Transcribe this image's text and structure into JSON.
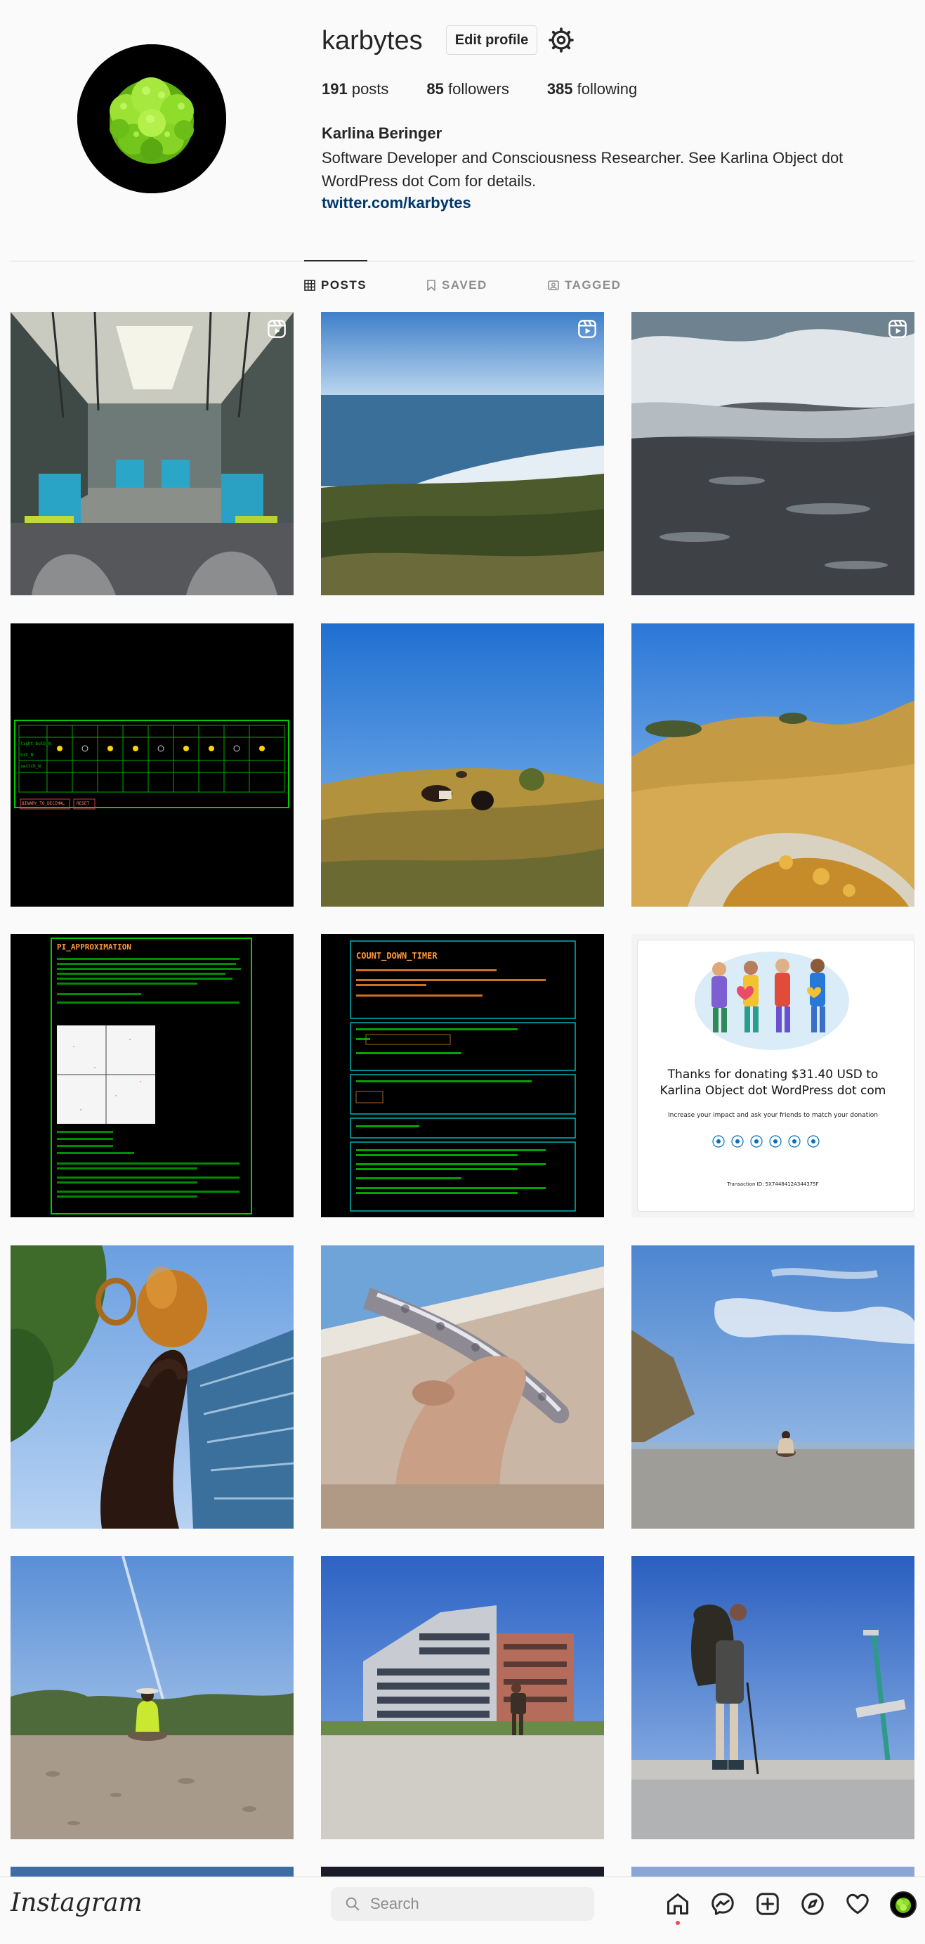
{
  "profile": {
    "username": "karbytes",
    "edit_label": "Edit profile",
    "posts_count": "191",
    "posts_label": " posts",
    "followers_count": "85",
    "followers_label": " followers",
    "following_count": "385",
    "following_label": " following",
    "full_name": "Karlina Beringer",
    "bio": "Software Developer and Consciousness Researcher. See Karlina Object dot WordPress dot Com for details.",
    "link": "twitter.com/karbytes"
  },
  "tabs": [
    {
      "label": "POSTS",
      "icon": "grid-icon",
      "active": true
    },
    {
      "label": "SAVED",
      "icon": "bookmark-icon",
      "active": false
    },
    {
      "label": "TAGGED",
      "icon": "tag-icon",
      "active": false
    }
  ],
  "posts": {
    "pi_title": "PI_APPROXIMATION",
    "timer_title": "COUNT_DOWN_TIMER",
    "donation_title_line1": "Thanks for donating $31.40 USD to",
    "donation_title_line2": "Karlina Object dot WordPress dot com",
    "donation_subtitle": "Increase your impact and ask your friends to match your donation",
    "donation_txn": "Transaction ID: 5X7448412A344375F",
    "table_row_labels": [
      "light_bulb_N",
      "bit_N",
      "switch_N"
    ],
    "table_header": [
      "8",
      "7",
      "6",
      "5",
      "4",
      "3",
      "2",
      "1",
      "0"
    ],
    "table_bits": [
      "1",
      "0",
      "1",
      "1",
      "0",
      "1",
      "1",
      "0",
      "1"
    ],
    "switch_label": "SWITCH",
    "binary_btn": "BINARY_TO_DECIMAL",
    "reset_btn": "RESET"
  },
  "bottom_bar": {
    "logo": "Instagram",
    "search_placeholder": "Search"
  },
  "colors": {
    "link": "#00376b",
    "text": "#262626",
    "muted": "#8e8e8e",
    "notification_dot": "#ed4956",
    "terminal_green": "#00ff00",
    "terminal_cyan": "#00cccc"
  }
}
